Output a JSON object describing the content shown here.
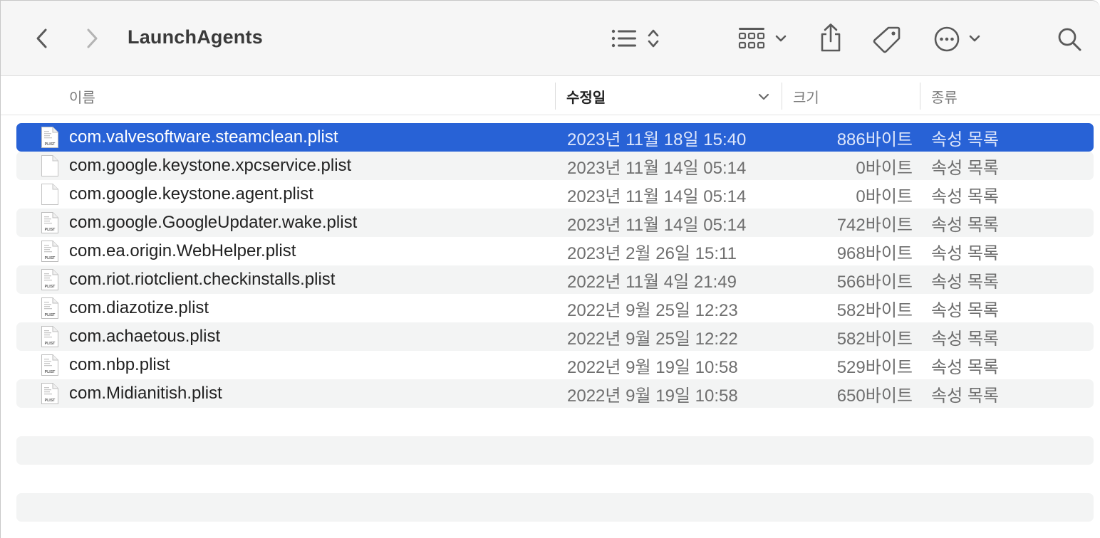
{
  "window": {
    "title": "LaunchAgents"
  },
  "toolbar": {
    "icons": [
      "chevron-left-icon",
      "chevron-right-icon",
      "list-view-icon",
      "sort-updown-icon",
      "group-grid-icon",
      "chevron-down-icon",
      "share-icon",
      "tag-icon",
      "more-ellipsis-icon",
      "chevron-down-icon",
      "search-icon"
    ]
  },
  "columns": {
    "name": "이름",
    "date": "수정일",
    "size": "크기",
    "kind": "종류"
  },
  "files": [
    {
      "name": "com.valvesoftware.steamclean.plist",
      "date": "2023년 11월 18일 15:40",
      "size": "886바이트",
      "kind": "속성 목록",
      "icon": "plist-file-icon",
      "selected": true
    },
    {
      "name": "com.google.keystone.xpcservice.plist",
      "date": "2023년 11월 14일 05:14",
      "size": "0바이트",
      "kind": "속성 목록",
      "icon": "blank-file-icon",
      "selected": false
    },
    {
      "name": "com.google.keystone.agent.plist",
      "date": "2023년 11월 14일 05:14",
      "size": "0바이트",
      "kind": "속성 목록",
      "icon": "blank-file-icon",
      "selected": false
    },
    {
      "name": "com.google.GoogleUpdater.wake.plist",
      "date": "2023년 11월 14일 05:14",
      "size": "742바이트",
      "kind": "속성 목록",
      "icon": "plist-file-icon",
      "selected": false
    },
    {
      "name": "com.ea.origin.WebHelper.plist",
      "date": "2023년 2월 26일 15:11",
      "size": "968바이트",
      "kind": "속성 목록",
      "icon": "plist-file-icon",
      "selected": false
    },
    {
      "name": "com.riot.riotclient.checkinstalls.plist",
      "date": "2022년 11월 4일 21:49",
      "size": "566바이트",
      "kind": "속성 목록",
      "icon": "plist-file-icon",
      "selected": false
    },
    {
      "name": "com.diazotize.plist",
      "date": "2022년 9월 25일 12:23",
      "size": "582바이트",
      "kind": "속성 목록",
      "icon": "plist-file-icon",
      "selected": false
    },
    {
      "name": "com.achaetous.plist",
      "date": "2022년 9월 25일 12:22",
      "size": "582바이트",
      "kind": "속성 목록",
      "icon": "plist-file-icon",
      "selected": false
    },
    {
      "name": "com.nbp.plist",
      "date": "2022년 9월 19일 10:58",
      "size": "529바이트",
      "kind": "속성 목록",
      "icon": "plist-file-icon",
      "selected": false
    },
    {
      "name": "com.Midianitish.plist",
      "date": "2022년 9월 19일 10:58",
      "size": "650바이트",
      "kind": "속성 목록",
      "icon": "plist-file-icon",
      "selected": false
    }
  ],
  "file_icon_label": "PLIST",
  "colors": {
    "selection": "#2862d6",
    "alt_row": "#f3f4f4",
    "toolbar_bg": "#f6f6f6"
  }
}
